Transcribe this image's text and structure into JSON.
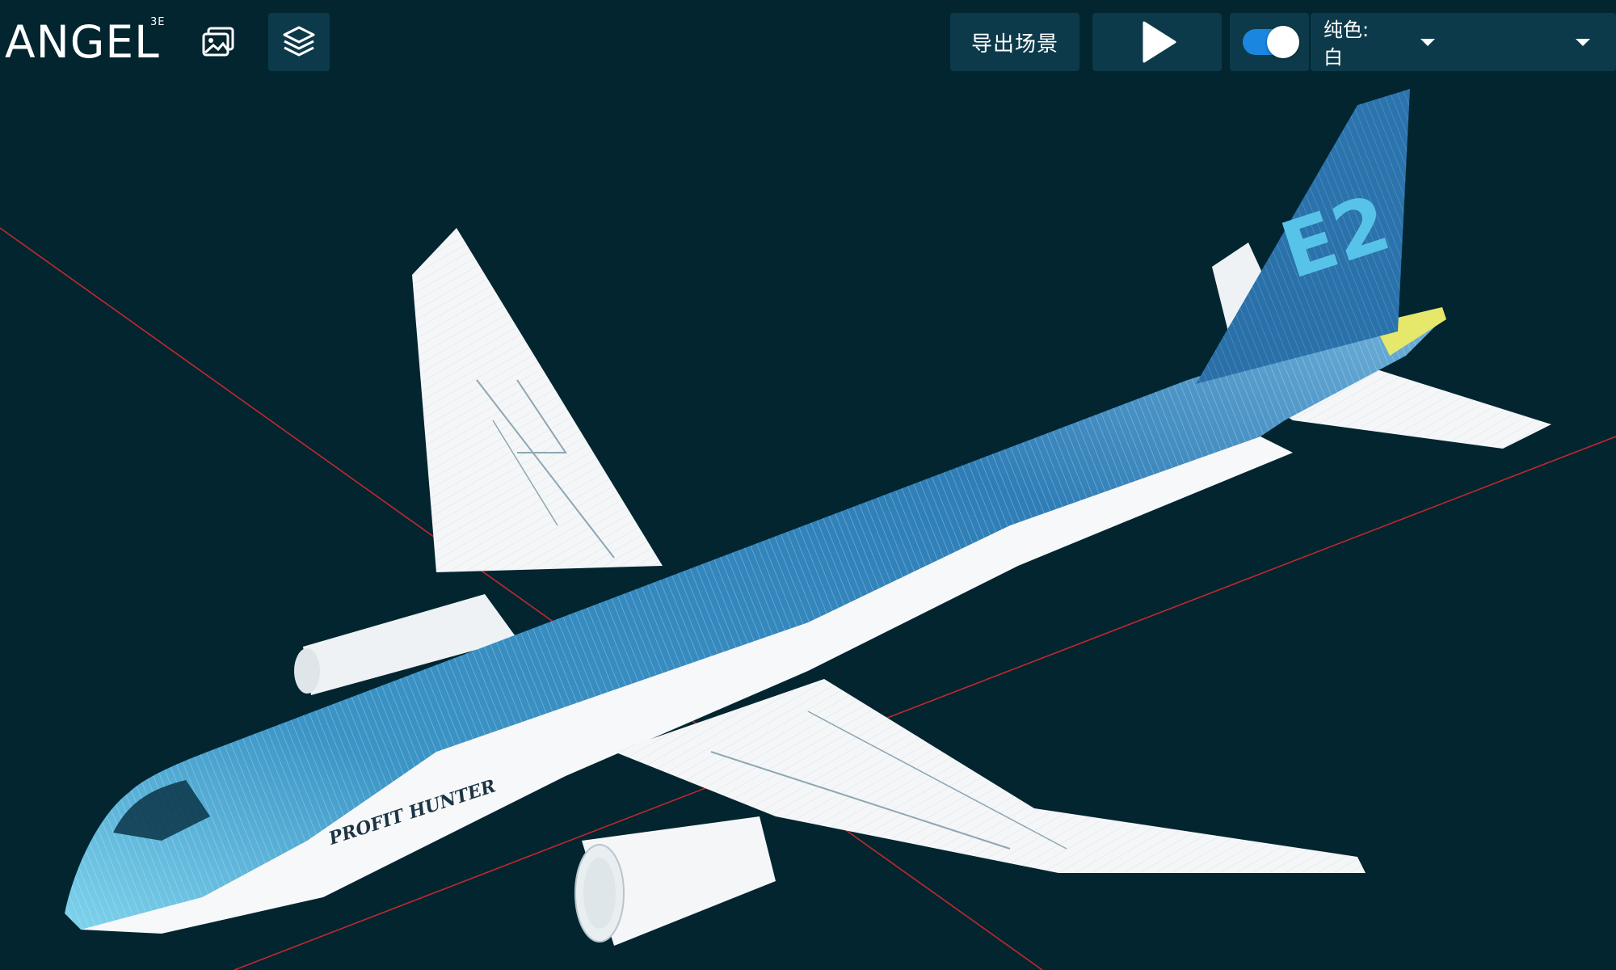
{
  "app": {
    "logo_text": "ANGEL",
    "logo_superscript": "3E"
  },
  "toolbar": {
    "gallery_icon": "image-gallery-icon",
    "layers_icon": "layers-icon",
    "export_label": "导出场景",
    "play_icon": "play-icon",
    "toggle_on": true,
    "color_select": {
      "label": "纯色:",
      "value": "白"
    }
  },
  "scene": {
    "model_tail_text": "E2",
    "model_fuselage_text": "PROFIT HUNTER",
    "colors": {
      "background": "#022530",
      "axis_line": "#c0282d",
      "fuselage_blue": "#2f7db6",
      "wing_white": "#f4f6f8",
      "accent": "#1a86e0"
    }
  }
}
